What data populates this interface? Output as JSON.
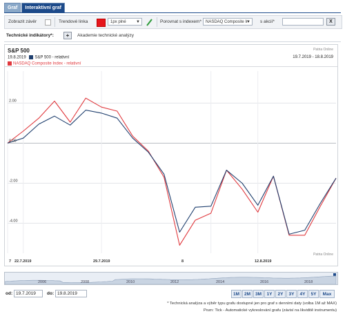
{
  "tabs": [
    {
      "label": "Graf",
      "active": false
    },
    {
      "label": "Interaktivní graf",
      "active": true
    }
  ],
  "toolbar": {
    "show_close_label": "Zobrazit závěr",
    "trend_line_label": "Trendové linka",
    "line_style_value": "1px plné",
    "compare_index_label": "Porovnat s indexem*",
    "compare_index_value": "NASDAQ Composite Ir",
    "compare_stock_label": "s akcií*",
    "compare_stock_value": "",
    "clear_label": "X"
  },
  "indicators": {
    "label": "Technické indikátory*:",
    "add_label": "+",
    "academy_link": "Akademie technické analýzy"
  },
  "chart": {
    "title": "S&P 500",
    "source_top": "Patria Online",
    "source_bottom": "Patria Online",
    "legend_date": "19.8.2019",
    "range_text": "19.7.2019 - 18.8.2019",
    "series_labels": [
      "S&P 500 - relativní",
      "NASDAQ Composite Index - relativní"
    ]
  },
  "chart_data": {
    "type": "line",
    "title": "S&P 500",
    "x_tick_labels": [
      "7",
      "22.7.2019",
      "29.7.2019",
      "8",
      "12.8.2019"
    ],
    "y_tick_labels": [
      "2.00",
      "0.00",
      "-2.00",
      "-4.00"
    ],
    "ylim": [
      -5.5,
      3.6
    ],
    "grid": true,
    "legend_placement": "top-left",
    "x": [
      "19.7.2019",
      "22.7.2019",
      "23.7.2019",
      "24.7.2019",
      "25.7.2019",
      "26.7.2019",
      "29.7.2019",
      "30.7.2019",
      "31.7.2019",
      "1.8.2019",
      "2.8.2019",
      "5.8.2019",
      "6.8.2019",
      "7.8.2019",
      "8.8.2019",
      "9.8.2019",
      "12.8.2019",
      "13.8.2019",
      "14.8.2019",
      "15.8.2019",
      "16.8.2019",
      "19.8.2019"
    ],
    "series": [
      {
        "name": "S&P 500 - relativní",
        "color": "#1f3f6e",
        "values": [
          0.0,
          0.25,
          0.95,
          1.35,
          0.9,
          1.65,
          1.5,
          1.25,
          0.25,
          -0.45,
          -1.55,
          -4.45,
          -3.2,
          -3.15,
          -1.35,
          -2.0,
          -3.1,
          -1.65,
          -4.55,
          -4.35,
          -3.0,
          -1.75
        ]
      },
      {
        "name": "NASDAQ Composite Index - relativní",
        "color": "#e0383d",
        "values": [
          0.0,
          0.6,
          1.25,
          2.1,
          1.05,
          2.25,
          1.8,
          1.6,
          0.35,
          -0.4,
          -1.7,
          -5.1,
          -3.85,
          -3.5,
          -1.35,
          -2.3,
          -3.45,
          -1.65,
          -4.6,
          -4.6,
          -3.15,
          -1.75
        ]
      }
    ]
  },
  "navigator": {
    "years": [
      "2006",
      "2008",
      "2010",
      "2012",
      "2014",
      "2016",
      "2018"
    ]
  },
  "range": {
    "from_label": "od:",
    "from_value": "19.7.2019",
    "to_label": "do:",
    "to_value": "19.8.2019",
    "buttons": [
      "1M",
      "2M",
      "3M",
      "1Y",
      "2Y",
      "3Y",
      "4Y",
      "5Y",
      "Max"
    ]
  },
  "notes": {
    "line1": "* Technická analýza a výběr typu grafu dostupné jen pro graf s denními daty (volba 1M až MAX)",
    "line2": "Pozn: Tick - Automatické vykreslování grafu (závisí na likviditě instrumentu)"
  },
  "colors": {
    "tab_active": "#1d4a8a",
    "sp500_line": "#1f3f6e",
    "nasdaq_line": "#e0383d",
    "trend_swatch": "#e6161c"
  }
}
